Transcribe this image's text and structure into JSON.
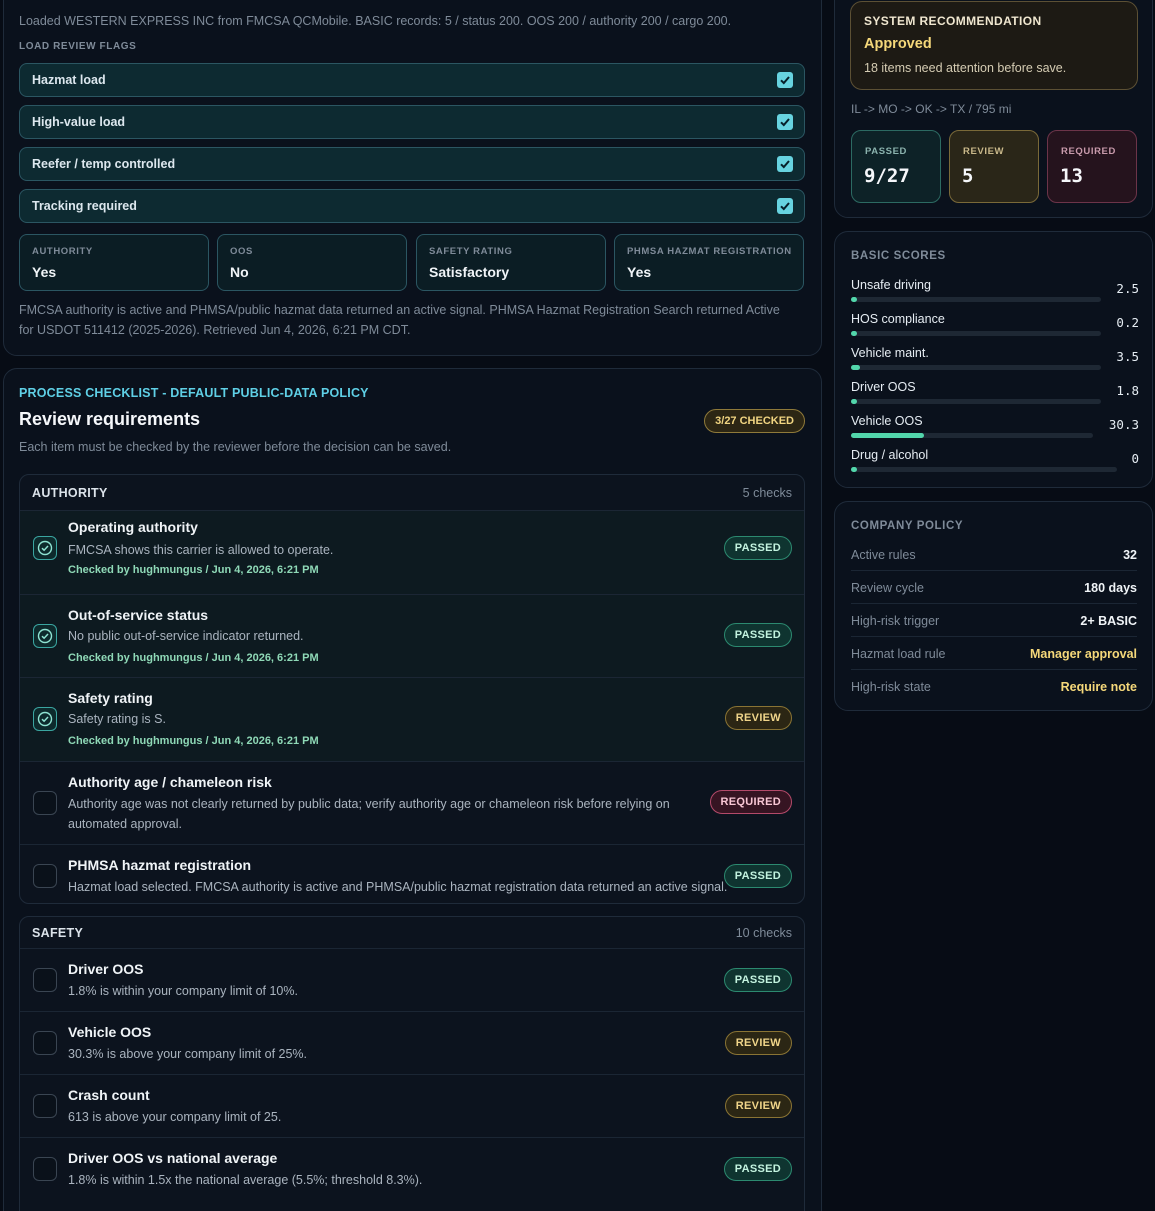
{
  "carrier_panel": {
    "loaded_text": "Loaded WESTERN EXPRESS INC from FMCSA QCMobile. BASIC records: 5 / status 200. OOS 200 / authority 200 / cargo 200.",
    "flags_heading": "LOAD REVIEW FLAGS",
    "flags": [
      {
        "label": "Hazmat load",
        "checked": true
      },
      {
        "label": "High-value load",
        "checked": true
      },
      {
        "label": "Reefer / temp controlled",
        "checked": true
      },
      {
        "label": "Tracking required",
        "checked": true
      }
    ],
    "stats": [
      {
        "key": "AUTHORITY",
        "value": "Yes"
      },
      {
        "key": "OOS",
        "value": "No"
      },
      {
        "key": "SAFETY RATING",
        "value": "Satisfactory"
      },
      {
        "key": "PHMSA HAZMAT REGISTRATION",
        "value": "Yes"
      }
    ],
    "note": "FMCSA authority is active and PHMSA/public hazmat data returned an active signal. PHMSA Hazmat Registration Search returned Active for USDOT 511412 (2025-2026). Retrieved Jun 4, 2026, 6:21 PM CDT."
  },
  "checklist": {
    "eyebrow": "PROCESS CHECKLIST - DEFAULT PUBLIC-DATA POLICY",
    "title": "Review requirements",
    "checked_pill": "3/27 CHECKED",
    "subtitle": "Each item must be checked by the reviewer before the decision can be saved.",
    "groups": [
      {
        "title": "AUTHORITY",
        "count": "5 checks",
        "items": [
          {
            "title": "Operating authority",
            "desc": "FMCSA shows this carrier is allowed to operate.",
            "by": "Checked by hughmungus / Jun 4, 2026, 6:21 PM",
            "status": "PASSED",
            "checked": true
          },
          {
            "title": "Out-of-service status",
            "desc": "No public out-of-service indicator returned.",
            "by": "Checked by hughmungus / Jun 4, 2026, 6:21 PM",
            "status": "PASSED",
            "checked": true
          },
          {
            "title": "Safety rating",
            "desc": "Safety rating is S.",
            "by": "Checked by hughmungus / Jun 4, 2026, 6:21 PM",
            "status": "REVIEW",
            "checked": true
          },
          {
            "title": "Authority age / chameleon risk",
            "desc": "Authority age was not clearly returned by public data; verify authority age or chameleon risk before relying on automated approval.",
            "status": "REQUIRED",
            "checked": false
          },
          {
            "title": "PHMSA hazmat registration",
            "desc": "Hazmat load selected. FMCSA authority is active and PHMSA/public hazmat registration data returned an active signal.",
            "status": "PASSED",
            "checked": false
          }
        ]
      },
      {
        "title": "SAFETY",
        "count": "10 checks",
        "items": [
          {
            "title": "Driver OOS",
            "desc": "1.8% is within your company limit of 10%.",
            "status": "PASSED",
            "checked": false
          },
          {
            "title": "Vehicle OOS",
            "desc": "30.3% is above your company limit of 25%.",
            "status": "REVIEW",
            "checked": false
          },
          {
            "title": "Crash count",
            "desc": "613 is above your company limit of 25.",
            "status": "REVIEW",
            "checked": false
          },
          {
            "title": "Driver OOS vs national average",
            "desc": "1.8% is within 1.5x the national average (5.5%; threshold 8.3%).",
            "status": "PASSED",
            "checked": false
          }
        ]
      }
    ]
  },
  "recommendation": {
    "heading": "SYSTEM RECOMMENDATION",
    "value": "Approved",
    "subtext": "18 items need attention before save.",
    "route": "IL -> MO -> OK -> TX / 795 mi",
    "counts": [
      {
        "key": "PASSED",
        "value": "9/27"
      },
      {
        "key": "REVIEW",
        "value": "5"
      },
      {
        "key": "REQUIRED",
        "value": "13"
      }
    ]
  },
  "basic_scores": {
    "heading": "BASIC SCORES",
    "scores": [
      {
        "name": "Unsafe driving",
        "value": "2.5",
        "level": 0.025
      },
      {
        "name": "HOS compliance",
        "value": "0.2",
        "level": 0.002
      },
      {
        "name": "Vehicle maint.",
        "value": "3.5",
        "level": 0.035
      },
      {
        "name": "Driver OOS",
        "value": "1.8",
        "level": 0.018
      },
      {
        "name": "Vehicle OOS",
        "value": "30.3",
        "level": 0.303
      },
      {
        "name": "Drug / alcohol",
        "value": "0",
        "level": 0
      }
    ],
    "accent": "#52d6ab"
  },
  "company_policy": {
    "heading": "COMPANY POLICY",
    "rows": [
      {
        "key": "Active rules",
        "value": "32"
      },
      {
        "key": "Review cycle",
        "value": "180 days"
      },
      {
        "key": "High-risk trigger",
        "value": "2+ BASIC"
      },
      {
        "key": "Hazmat load rule",
        "value": "Manager approval"
      },
      {
        "key": "High-risk state",
        "value": "Require note"
      }
    ]
  }
}
